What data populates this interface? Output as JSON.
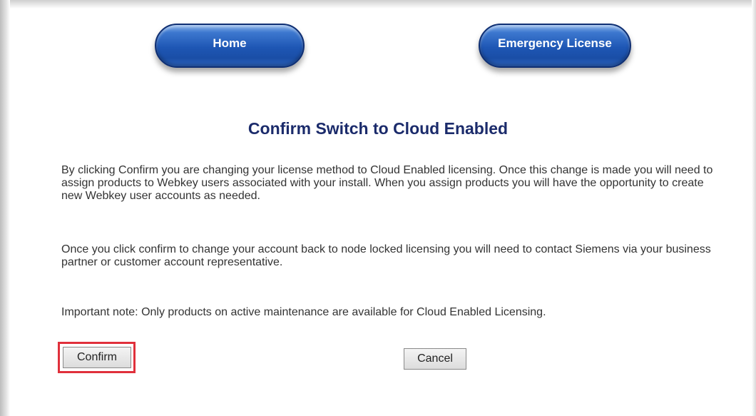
{
  "nav": {
    "home_label": "Home",
    "emergency_label": "Emergency License"
  },
  "page": {
    "title": "Confirm Switch to Cloud Enabled",
    "paragraph1": "By clicking Confirm you are changing your license method to Cloud Enabled licensing. Once this change is made you will need to assign products to Webkey users associated with your install. When you assign products you will have the opportunity to create new Webkey user accounts as needed.",
    "paragraph2": "Once you click confirm to change your account back to node locked licensing you will need to contact Siemens via your business partner or customer account representative.",
    "paragraph3": "Important note: Only products on active maintenance are available for Cloud Enabled Licensing."
  },
  "actions": {
    "confirm_label": "Confirm",
    "cancel_label": "Cancel"
  },
  "colors": {
    "heading": "#1b2b6b",
    "nav_button": "#1e56b4",
    "highlight": "#e0303b"
  }
}
